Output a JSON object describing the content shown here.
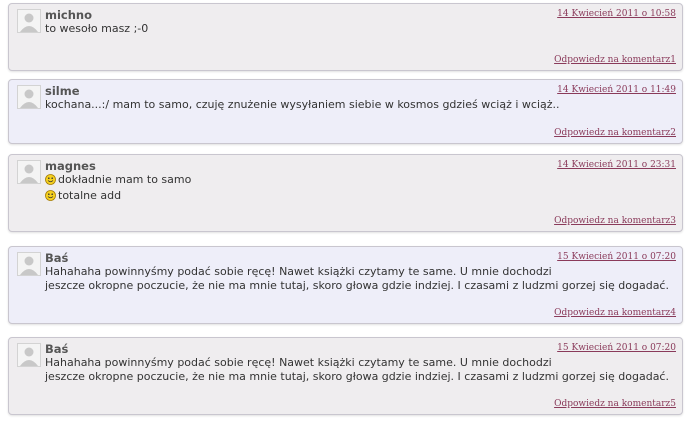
{
  "comments": [
    {
      "author": "michno",
      "date": "14 Kwiecień 2011 o 10:58",
      "lines": [
        "to wesoło masz ;-0"
      ],
      "reply": "Odpowiedz na komentarz1"
    },
    {
      "author": "silme",
      "date": "14 Kwiecień 2011 o 11:49",
      "lines": [
        "kochana...:/ mam to samo, czuję znużenie wysyłaniem siebie w kosmos gdzieś wciąż i wciąż.."
      ],
      "reply": "Odpowiedz na komentarz2"
    },
    {
      "author": "magnes",
      "date": "14 Kwiecień 2011 o 23:31",
      "lines": [
        "dokładnie mam to samo",
        "totalne add"
      ],
      "smileys": true,
      "reply": "Odpowiedz na komentarz3"
    },
    {
      "author": "Baś",
      "date": "15 Kwiecień 2011 o 07:20",
      "lines": [
        "Hahahaha powinnyśmy podać sobie ręcę! Nawet książki czytamy te same. U mnie dochodzi",
        "jeszcze okropne poczucie, że nie ma mnie tutaj, skoro głowa gdzie indziej. I czasami z ludzmi gorzej się dogadać."
      ],
      "reply": "Odpowiedz na komentarz4"
    },
    {
      "author": "Baś",
      "date": "15 Kwiecień 2011 o 07:20",
      "lines": [
        "Hahahaha powinnyśmy podać sobie ręcę! Nawet książki czytamy te same. U mnie dochodzi",
        "jeszcze okropne poczucie, że nie ma mnie tutaj, skoro głowa gdzie indziej. I czasami z ludzmi gorzej się dogadać."
      ],
      "reply": "Odpowiedz na komentarz5"
    }
  ],
  "colors": {
    "link": "#8a3a5a",
    "odd_bg": "#efedef",
    "even_bg": "#eeeef9",
    "text": "#333333",
    "author": "#555555"
  }
}
